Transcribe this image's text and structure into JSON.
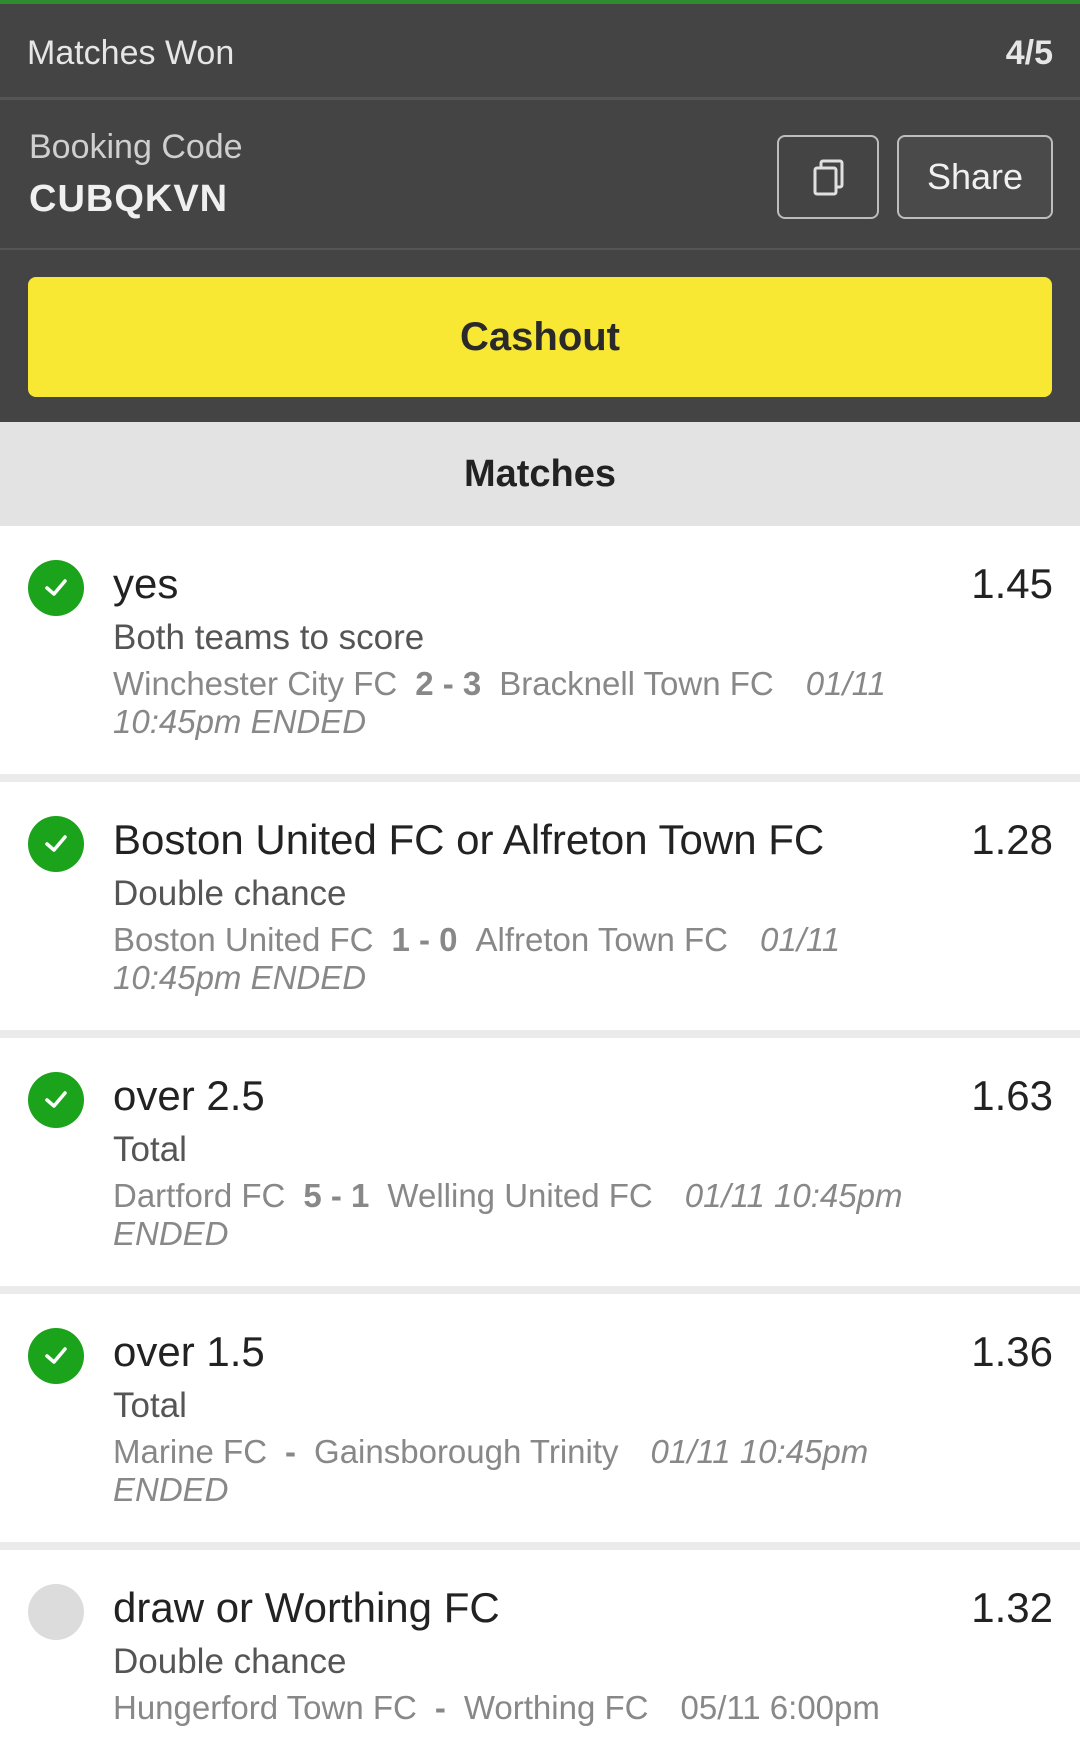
{
  "summary": {
    "matches_won_label": "Matches Won",
    "matches_won_value": "4/5",
    "booking_label": "Booking Code",
    "booking_code": "CUBQKVN",
    "share_label": "Share",
    "cashout_label": "Cashout",
    "matches_heading": "Matches"
  },
  "colors": {
    "won": "#1ba31b",
    "pending": "#dcdcdc",
    "cashout": "#f8e834",
    "header_dark": "#444444"
  },
  "matches": [
    {
      "status": "won",
      "pick": "yes",
      "odds": "1.45",
      "market": "Both teams to score",
      "home": "Winchester City FC",
      "score": "2 - 3",
      "away": "Bracknell Town FC",
      "date": "01/11",
      "time_status": "10:45pm ENDED"
    },
    {
      "status": "won",
      "pick": "Boston United FC or Alfreton Town FC",
      "odds": "1.28",
      "market": "Double chance",
      "home": "Boston United FC",
      "score": "1 - 0",
      "away": "Alfreton Town FC",
      "date": "01/11",
      "time_status": "10:45pm ENDED"
    },
    {
      "status": "won",
      "pick": "over 2.5",
      "odds": "1.63",
      "market": "Total",
      "home": "Dartford FC",
      "score": "5 - 1",
      "away": "Welling United FC",
      "date": "01/11 10:45pm",
      "time_status": "ENDED"
    },
    {
      "status": "won",
      "pick": "over 1.5",
      "odds": "1.36",
      "market": "Total",
      "home": "Marine FC",
      "score": "-",
      "away": "Gainsborough Trinity",
      "date": "01/11 10:45pm",
      "time_status": "ENDED"
    },
    {
      "status": "pending",
      "pick": "draw or Worthing FC",
      "odds": "1.32",
      "market": "Double chance",
      "home": "Hungerford Town FC",
      "score": "-",
      "away": "Worthing FC",
      "date": "05/11 6:00pm",
      "time_status": ""
    }
  ],
  "icons": {
    "status_won": "check-circle-icon",
    "status_pending": "empty-circle-icon",
    "copy": "copy-icon"
  }
}
